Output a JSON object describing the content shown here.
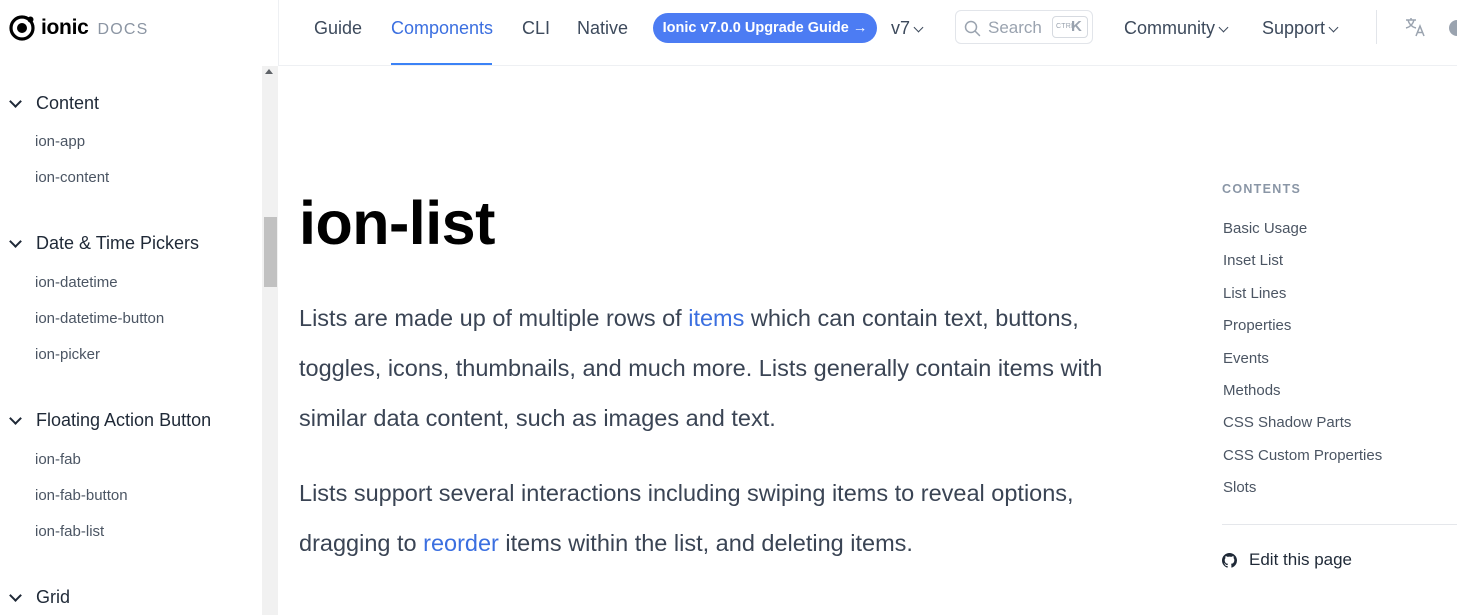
{
  "brand": {
    "name": "ionic",
    "suffix": "DOCS"
  },
  "nav": {
    "guide": "Guide",
    "components": "Components",
    "cli": "CLI",
    "native": "Native",
    "upgrade": "Ionic v7.0.0 Upgrade Guide →",
    "version": "v7",
    "search_placeholder": "Search",
    "kbd_ctrl": "CTRL",
    "kbd_key": "K",
    "community": "Community",
    "support": "Support",
    "active_tab": "Components",
    "accent_color": "#4c7cf3"
  },
  "sidebar": {
    "groups": [
      {
        "title": "Content",
        "items": [
          "ion-app",
          "ion-content"
        ]
      },
      {
        "title": "Date & Time Pickers",
        "items": [
          "ion-datetime",
          "ion-datetime-button",
          "ion-picker"
        ]
      },
      {
        "title": "Floating Action Button",
        "items": [
          "ion-fab",
          "ion-fab-button",
          "ion-fab-list"
        ]
      },
      {
        "title": "Grid",
        "items": []
      }
    ]
  },
  "main": {
    "title": "ion-list",
    "p1": {
      "before": "Lists are made up of multiple rows of ",
      "link": "items",
      "after": " which can contain text, buttons, toggles, icons, thumbnails, and much more. Lists generally contain items with similar data content, such as images and text."
    },
    "p2": {
      "before": "Lists support several interactions including swiping items to reveal options, dragging to ",
      "link": "reorder",
      "after": " items within the list, and deleting items."
    }
  },
  "toc": {
    "heading": "CONTENTS",
    "items": [
      "Basic Usage",
      "Inset List",
      "List Lines",
      "Properties",
      "Events",
      "Methods",
      "CSS Shadow Parts",
      "CSS Custom Properties",
      "Slots"
    ],
    "edit": "Edit this page"
  },
  "icons": [
    "ionic-logo-icon",
    "search-icon",
    "translate-icon",
    "theme-toggle-icon",
    "github-icon",
    "chevron-down-icon"
  ]
}
